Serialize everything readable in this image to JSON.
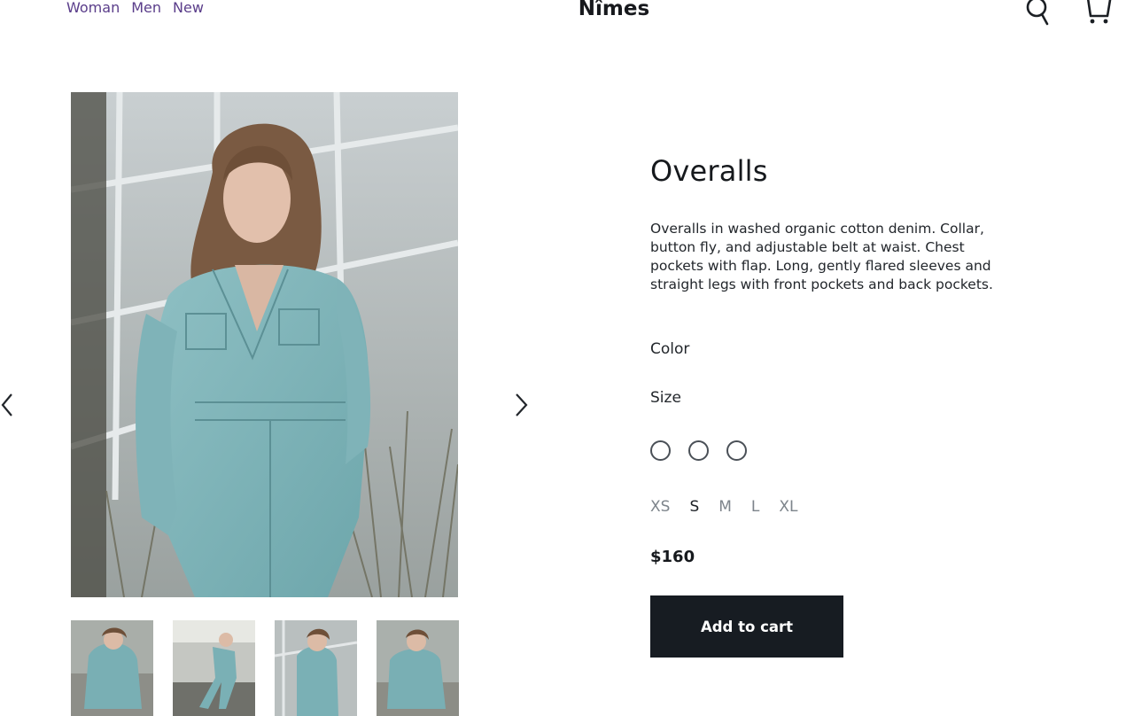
{
  "header": {
    "nav": [
      {
        "label": "Woman"
      },
      {
        "label": "Men"
      },
      {
        "label": "New"
      }
    ],
    "brand": "Nîmes",
    "icons": [
      "search-icon",
      "cart-icon"
    ]
  },
  "gallery": {
    "main_image": "woman-in-denim-overalls-photo",
    "thumbnails": [
      {
        "name": "thumbnail-sitting"
      },
      {
        "name": "thumbnail-walking"
      },
      {
        "name": "thumbnail-standing"
      },
      {
        "name": "thumbnail-crouching"
      }
    ],
    "icons": [
      "chevron-left-icon",
      "chevron-right-icon"
    ]
  },
  "product": {
    "title": "Overalls",
    "description": "Overalls in washed organic cotton denim. Collar, button fly, and adjustable belt at waist. Chest pockets with flap. Long, gently flared sleeves and straight legs with front pockets and back pockets.",
    "color_label": "Color",
    "size_label": "Size",
    "swatch_count": 3,
    "sizes": [
      "XS",
      "S",
      "M",
      "L",
      "XL"
    ],
    "selected_size": "S",
    "price": "$160",
    "add_to_cart": "Add to cart"
  },
  "colors": {
    "nav_link": "#5a3d8a",
    "button_bg": "#171c22",
    "text_dark": "#16191d",
    "size_muted": "#7d848b"
  }
}
